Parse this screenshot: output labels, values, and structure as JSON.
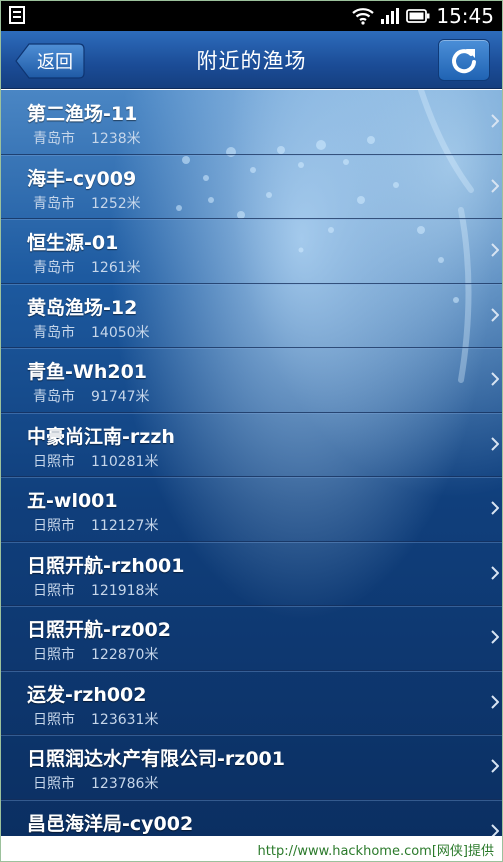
{
  "status_bar": {
    "time": "15:45"
  },
  "header": {
    "back_label": "返回",
    "title": "附近的渔场"
  },
  "items": [
    {
      "name": "第二渔场-11",
      "city": "青岛市",
      "distance": "1238米"
    },
    {
      "name": "海丰-cy009",
      "city": "青岛市",
      "distance": "1252米"
    },
    {
      "name": "恒生源-01",
      "city": "青岛市",
      "distance": "1261米"
    },
    {
      "name": "黄岛渔场-12",
      "city": "青岛市",
      "distance": "14050米"
    },
    {
      "name": "青鱼-Wh201",
      "city": "青岛市",
      "distance": "91747米"
    },
    {
      "name": "中豪尚江南-rzzh",
      "city": "日照市",
      "distance": "110281米"
    },
    {
      "name": "五-wl001",
      "city": "日照市",
      "distance": "112127米"
    },
    {
      "name": "日照开航-rzh001",
      "city": "日照市",
      "distance": "121918米"
    },
    {
      "name": "日照开航-rz002",
      "city": "日照市",
      "distance": "122870米"
    },
    {
      "name": "运发-rzh002",
      "city": "日照市",
      "distance": "123631米"
    },
    {
      "name": "日照润达水产有限公司-rz001",
      "city": "日照市",
      "distance": "123786米"
    },
    {
      "name": "昌邑海洋局-cy002",
      "city": "",
      "distance": ""
    }
  ],
  "watermark": "http://www.hackhome.com[网侠]提供",
  "colors": {
    "header_top": "#2d6cbc",
    "header_bottom": "#153f80",
    "list_bg_dark": "#0b2f62",
    "subtitle_text": "#c6d6ea",
    "watermark_text": "#2b7a2b"
  }
}
